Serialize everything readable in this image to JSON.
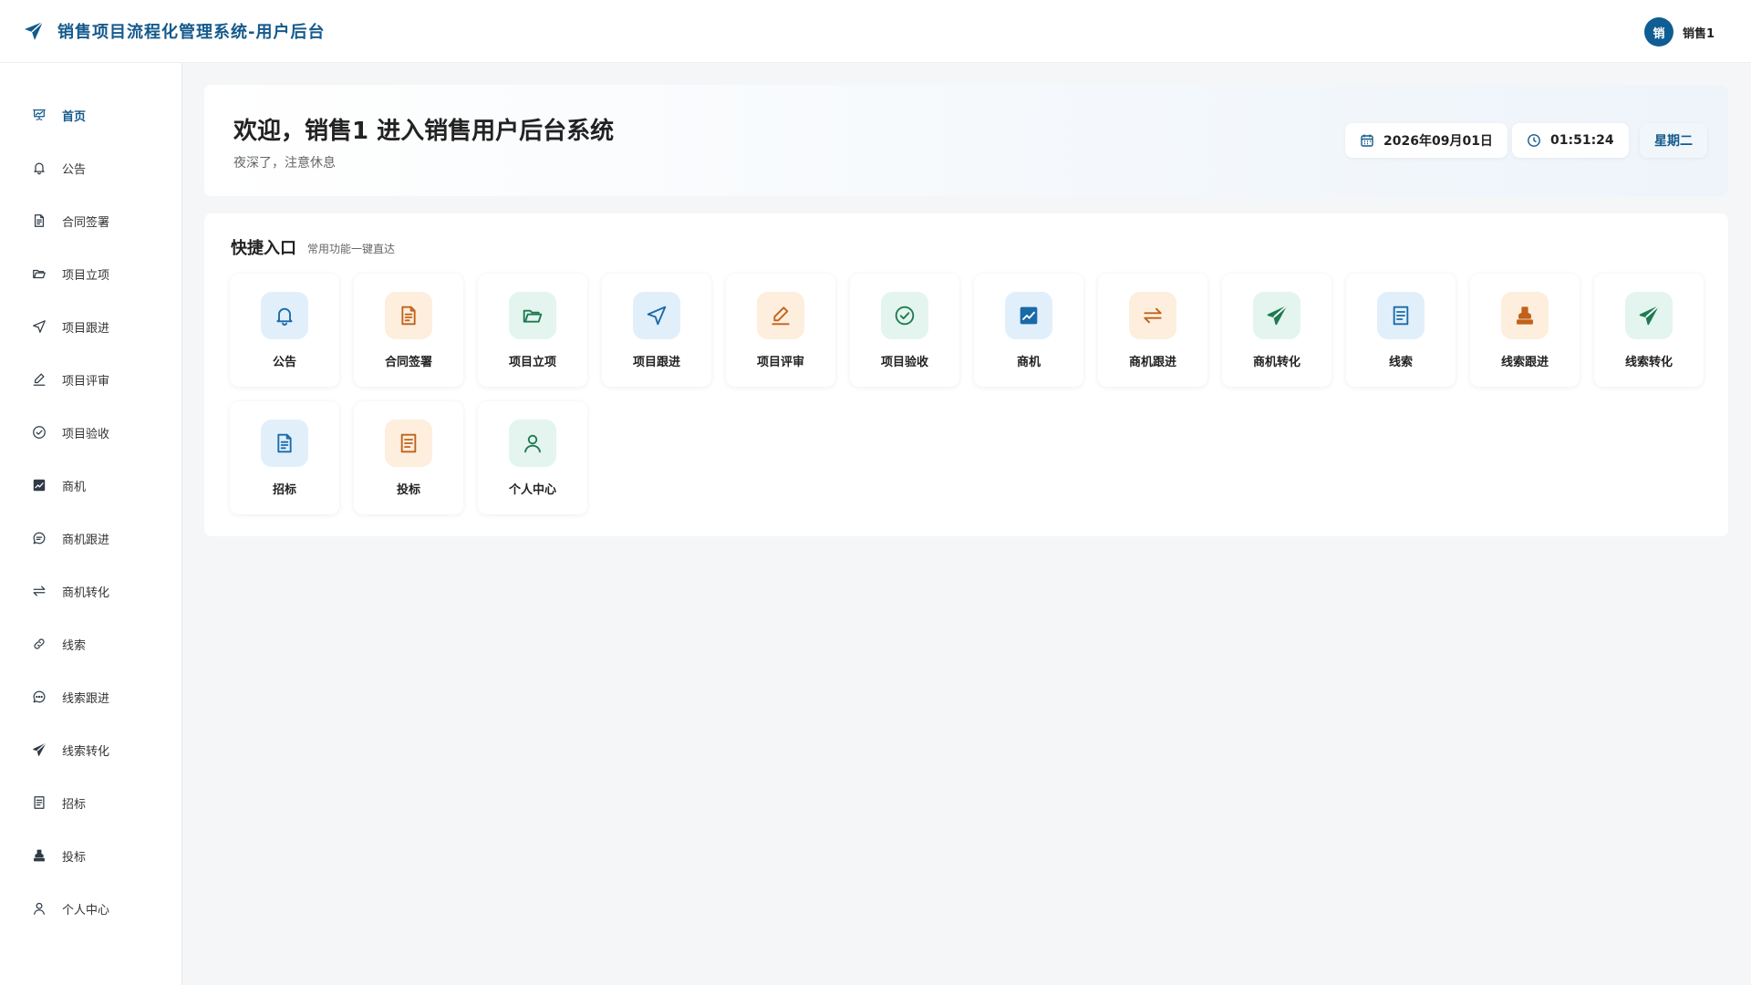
{
  "header": {
    "title": "销售项目流程化管理系统-用户后台",
    "avatar_text": "销",
    "username": "销售1"
  },
  "sidebar": {
    "items": [
      {
        "label": "首页",
        "icon": "presentation-chart-icon",
        "active": true
      },
      {
        "label": "公告",
        "icon": "bell-icon"
      },
      {
        "label": "合同签署",
        "icon": "document-icon"
      },
      {
        "label": "项目立项",
        "icon": "folder-open-icon"
      },
      {
        "label": "项目跟进",
        "icon": "navigation-arrow-icon"
      },
      {
        "label": "项目评审",
        "icon": "pen-icon"
      },
      {
        "label": "项目验收",
        "icon": "check-circle-icon"
      },
      {
        "label": "商机",
        "icon": "line-chart-icon"
      },
      {
        "label": "商机跟进",
        "icon": "chat-bubble-icon"
      },
      {
        "label": "商机转化",
        "icon": "swap-arrows-icon"
      },
      {
        "label": "线索",
        "icon": "link-chain-icon"
      },
      {
        "label": "线索跟进",
        "icon": "chat-dots-icon"
      },
      {
        "label": "线索转化",
        "icon": "paper-plane-icon"
      },
      {
        "label": "招标",
        "icon": "list-document-icon"
      },
      {
        "label": "投标",
        "icon": "stamp-icon"
      },
      {
        "label": "个人中心",
        "icon": "user-icon"
      }
    ]
  },
  "welcome": {
    "title": "欢迎，销售1 进入销售用户后台系统",
    "subtitle": "夜深了，注意休息",
    "date": "2026年09月01日",
    "time": "01:51:24",
    "weekday": "星期二"
  },
  "quick": {
    "title": "快捷入口",
    "subtitle": "常用功能一键直达",
    "tiles": [
      {
        "label": "公告",
        "icon": "bell-icon",
        "color": "blue"
      },
      {
        "label": "合同签署",
        "icon": "document-icon",
        "color": "orange"
      },
      {
        "label": "项目立项",
        "icon": "folder-open-icon",
        "color": "green"
      },
      {
        "label": "项目跟进",
        "icon": "navigation-arrow-icon",
        "color": "blue"
      },
      {
        "label": "项目评审",
        "icon": "pen-icon",
        "color": "orange"
      },
      {
        "label": "项目验收",
        "icon": "check-circle-icon",
        "color": "green"
      },
      {
        "label": "商机",
        "icon": "line-chart-icon",
        "color": "blue"
      },
      {
        "label": "商机跟进",
        "icon": "swap-arrows-icon",
        "color": "orange"
      },
      {
        "label": "商机转化",
        "icon": "paper-plane-icon",
        "color": "green"
      },
      {
        "label": "线索",
        "icon": "list-document-icon",
        "color": "blue"
      },
      {
        "label": "线索跟进",
        "icon": "stamp-icon",
        "color": "orange"
      },
      {
        "label": "线索转化",
        "icon": "paper-plane-icon",
        "color": "green"
      },
      {
        "label": "招标",
        "icon": "document-icon",
        "color": "blue"
      },
      {
        "label": "投标",
        "icon": "list-document-icon",
        "color": "orange"
      },
      {
        "label": "个人中心",
        "icon": "user-icon",
        "color": "green"
      }
    ]
  },
  "colors": {
    "brand": "#145a8c",
    "tile_blue_bg": "#e1effb",
    "tile_orange_bg": "#fdeedd",
    "tile_green_bg": "#e3f5ee"
  }
}
